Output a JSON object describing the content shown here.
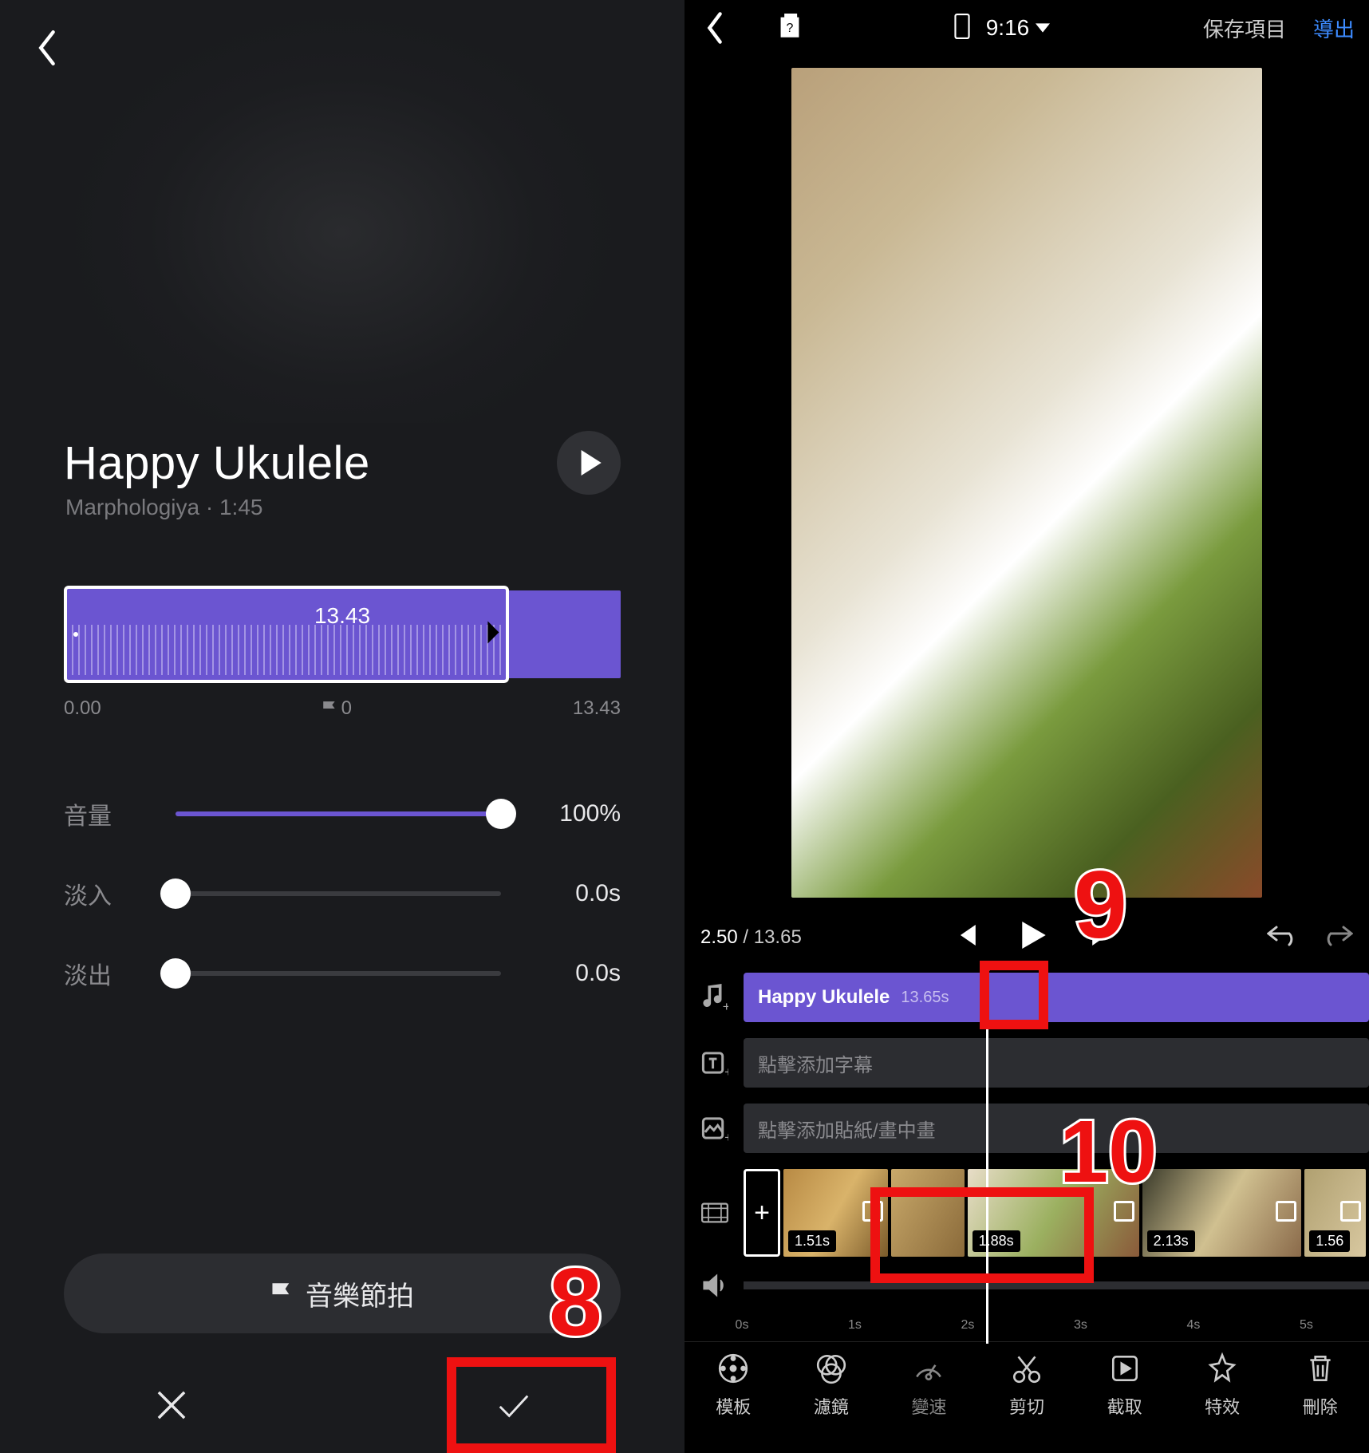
{
  "left": {
    "title": "Happy Ukulele",
    "artist_line": "Marphologiya · 1:45",
    "wave": {
      "duration": "13.43",
      "start": "0.00",
      "flag": "0",
      "end": "13.43"
    },
    "sliders": {
      "volume": {
        "label": "音量",
        "value": "100%",
        "fill": 100
      },
      "fadein": {
        "label": "淡入",
        "value": "0.0s",
        "fill": 0
      },
      "fadeout": {
        "label": "淡出",
        "value": "0.0s",
        "fill": 0
      }
    },
    "beat_button": "音樂節拍"
  },
  "right": {
    "header": {
      "ratio": "9:16",
      "save": "保存項目",
      "export": "導出"
    },
    "playbar": {
      "current": "2.50",
      "total": "13.65"
    },
    "tracks": {
      "music": {
        "name": "Happy Ukulele",
        "duration": "13.65s"
      },
      "subtitle_hint": "點擊添加字幕",
      "sticker_hint": "點擊添加貼紙/畫中畫"
    },
    "thumbs": [
      {
        "dur": "1.51s"
      },
      {
        "dur": ""
      },
      {
        "dur": "1.88s"
      },
      {
        "dur": "2.13s"
      },
      {
        "dur": "1.56"
      }
    ],
    "ruler": [
      "0s",
      "1s",
      "2s",
      "3s",
      "4s",
      "5s"
    ],
    "tools": [
      {
        "key": "template",
        "label": "模板"
      },
      {
        "key": "filter",
        "label": "濾鏡"
      },
      {
        "key": "speed",
        "label": "變速"
      },
      {
        "key": "trim",
        "label": "剪切"
      },
      {
        "key": "capture",
        "label": "截取"
      },
      {
        "key": "effect",
        "label": "特效"
      },
      {
        "key": "delete",
        "label": "刪除"
      }
    ]
  },
  "annotations": {
    "n8": "8",
    "n9": "9",
    "n10": "10"
  }
}
